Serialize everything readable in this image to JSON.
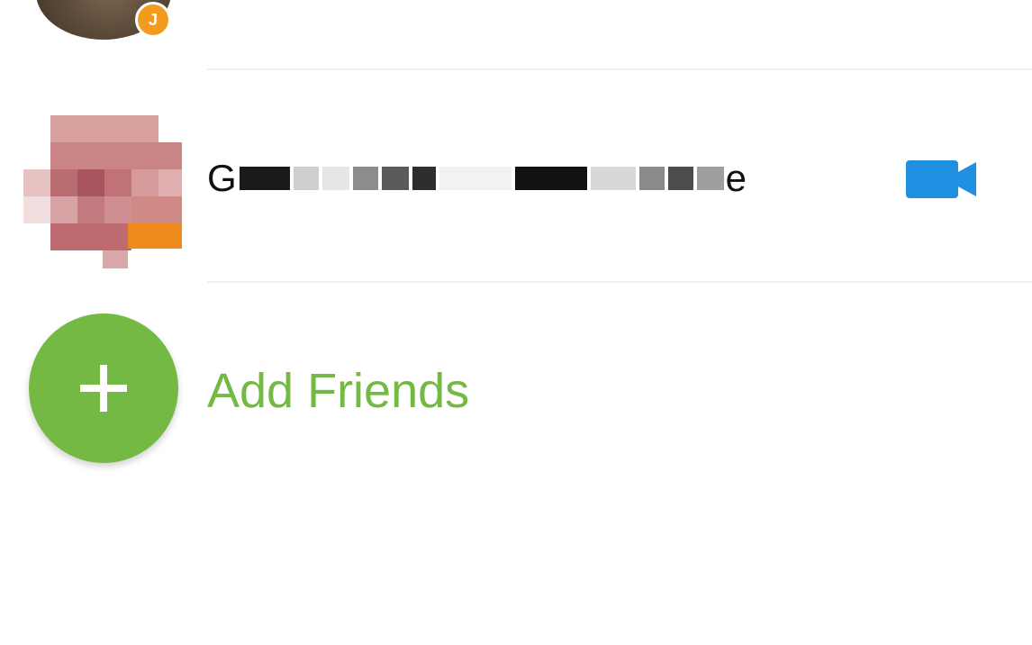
{
  "top_contact": {
    "status_badge_glyph": "J",
    "status_color": "#f39b1f"
  },
  "contact_row": {
    "name_visible_start": "G",
    "name_visible_end": "e",
    "video_icon": "video-camera-icon",
    "video_color": "#1e8fe1"
  },
  "add_friends": {
    "label": "Add Friends",
    "icon": "plus-icon",
    "color": "#74b943"
  }
}
